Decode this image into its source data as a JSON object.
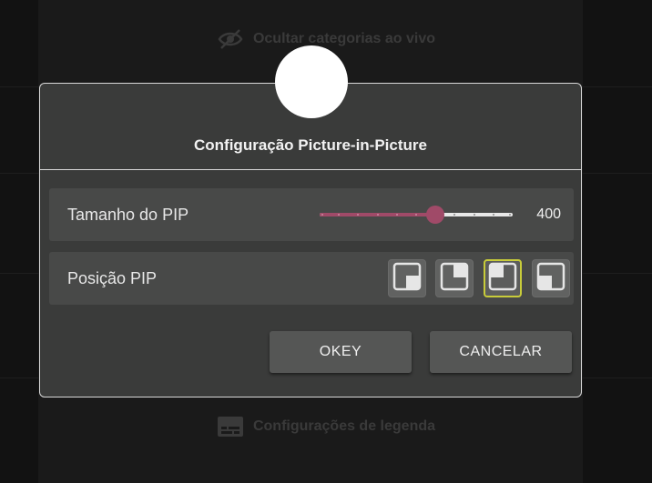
{
  "background": {
    "top_item": {
      "label": "Ocultar categorias ao vivo",
      "icon": "eye-off-icon"
    },
    "bottom_item": {
      "label": "Configurações de legenda",
      "icon": "subtitles-icon"
    }
  },
  "dialog": {
    "title": "Configuração Picture-in-Picture",
    "size_row": {
      "label": "Tamanho do PIP",
      "value": "400",
      "slider_fraction": 0.6,
      "tick_count": 10
    },
    "position_row": {
      "label": "Posição PIP",
      "options": [
        {
          "name": "bottom-right",
          "icon": "pip-bottom-right-icon"
        },
        {
          "name": "top-right",
          "icon": "pip-top-right-icon"
        },
        {
          "name": "top-left",
          "icon": "pip-top-left-icon"
        },
        {
          "name": "bottom-left",
          "icon": "pip-bottom-left-icon"
        }
      ],
      "selected_index": 2
    },
    "ok_label": "OKEY",
    "cancel_label": "CANCELAR"
  },
  "colors": {
    "accent": "#a04a68",
    "selected_border": "#c8cc3a",
    "dialog_bg": "#3a3b3a"
  }
}
